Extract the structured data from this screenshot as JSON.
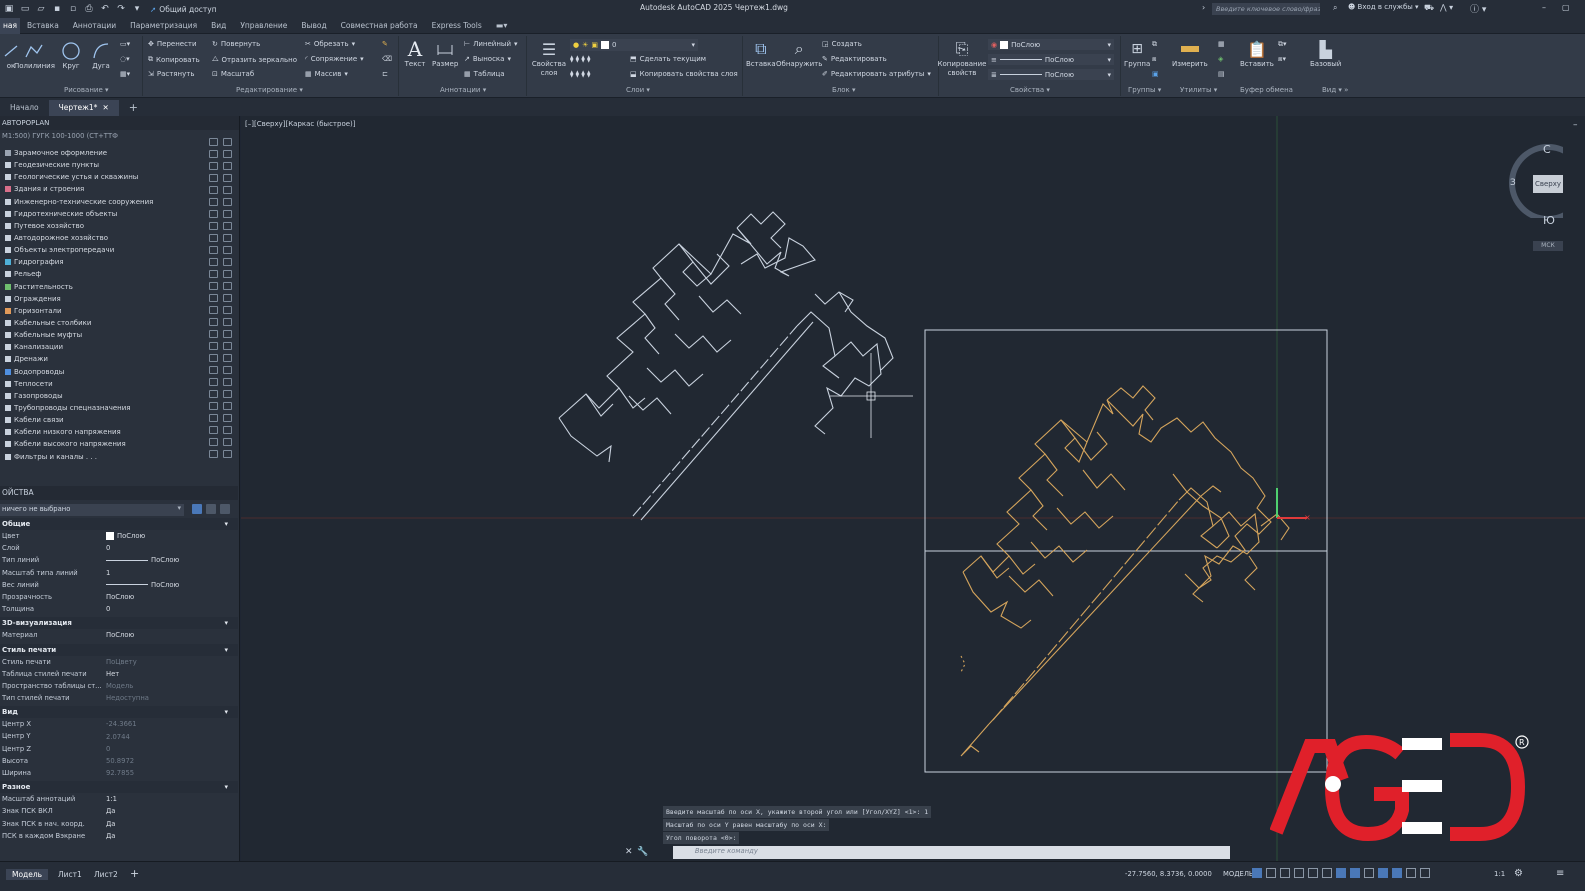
{
  "titlebar": {
    "share_label": "Общий доступ",
    "title": "Autodesk AutoCAD 2025    Чертеж1.dwg",
    "search_placeholder": "Введите ключевое слово/фразу",
    "login": "Вход в службы"
  },
  "menu": {
    "tabs": [
      "Главная",
      "Вставка",
      "Аннотации",
      "Параметризация",
      "Вид",
      "Управление",
      "Вывод",
      "Совместная работа",
      "Express Tools"
    ],
    "active_tab_visible": "ная"
  },
  "ribbon": {
    "draw": {
      "polyline": "Полилиния",
      "circle": "Круг",
      "arc": "Дуга",
      "line_partial": "ок",
      "panel": "Рисование"
    },
    "modify": {
      "move": "Перенести",
      "rotate": "Повернуть",
      "trim": "Обрезать",
      "copy": "Копировать",
      "mirror": "Отразить зеркально",
      "fillet": "Сопряжение",
      "stretch": "Растянуть",
      "scale": "Масштаб",
      "array": "Массив",
      "panel": "Редактирование"
    },
    "annotation": {
      "text": "Текст",
      "dimension": "Размер",
      "linear": "Линейный",
      "leader": "Выноска",
      "table": "Таблица",
      "panel": "Аннотации"
    },
    "layers": {
      "properties": "Свойства слоя",
      "current_layer": "0",
      "make_current": "Сделать текущим",
      "match_layer": "Копировать свойства слоя",
      "panel": "Слои"
    },
    "block": {
      "insert": "Вставка",
      "detect": "Обнаружить",
      "create": "Создать",
      "edit": "Редактировать",
      "edit_attr": "Редактировать атрибуты",
      "panel": "Блок"
    },
    "properties": {
      "match": "Копирование свойств",
      "color": "ПоСлою",
      "lineweight": "ПоСлою",
      "linetype": "ПоСлою",
      "panel": "Свойства"
    },
    "groups": {
      "group": "Группа",
      "panel": "Группы"
    },
    "utilities": {
      "measure": "Измерить",
      "panel": "Утилиты"
    },
    "clipboard": {
      "paste": "Вставить",
      "panel": "Буфер обмена"
    },
    "view": {
      "base": "Базовый",
      "panel": "Вид"
    }
  },
  "doctabs": {
    "start": "Начало",
    "drawing": "Чертеж1*",
    "new_tab": "+"
  },
  "layer_panel": {
    "title": "АВТОРОРLAN",
    "subtitle": "М1:500) ГУГК 100-1000 (СТ+ТТФ",
    "items": [
      "Зарамочное оформление",
      "Геодезические пункты",
      "Геологические устья и скважины",
      "Здания и строения",
      "Инженерно-технические сооружения",
      "Гидротехнические объекты",
      "Путевое хозяйство",
      "Автодорожное хозяйство",
      "Объекты электропередачи",
      "Гидрография",
      "Рельеф",
      "Растительность",
      "Ограждения",
      "Горизонтали",
      "Кабельные столбики",
      "Кабельные муфты",
      "Канализации",
      "Дренажи",
      "Водопроводы",
      "Теплосети",
      "Газопроводы",
      "Трубопроводы спецназначения",
      "Кабели связи",
      "Кабели низкого напряжения",
      "Кабели высокого напряжения",
      "Фильтры и каналы . . ."
    ],
    "item_colors": [
      "#9aa4b2",
      "#c9d2de",
      "#c9d2de",
      "#d86f8a",
      "#c9d2de",
      "#c9d2de",
      "#c9d2de",
      "#c9d2de",
      "#c9d2de",
      "#4fb0d8",
      "#c9d2de",
      "#6fbf6f",
      "#c9d2de",
      "#e09a5a",
      "#c9d2de",
      "#c9d2de",
      "#c9d2de",
      "#c9d2de",
      "#4f8fe0",
      "#c9d2de",
      "#c9d2de",
      "#c9d2de",
      "#c9d2de",
      "#c9d2de",
      "#c9d2de",
      "#c9d2de"
    ]
  },
  "properties": {
    "title": "ОЙСТВА",
    "selection": "ничего не выбрано",
    "sections": [
      {
        "name": "Общие",
        "rows": [
          {
            "k": "Цвет",
            "v": "ПоСлою",
            "type": "swatch"
          },
          {
            "k": "Слой",
            "v": "0"
          },
          {
            "k": "Тип линий",
            "v": "ПоСлою",
            "type": "line"
          },
          {
            "k": "Масштаб типа линий",
            "v": "1"
          },
          {
            "k": "Вес линий",
            "v": "ПоСлою",
            "type": "line"
          },
          {
            "k": "Прозрачность",
            "v": "ПоСлою"
          },
          {
            "k": "Толщина",
            "v": "0"
          }
        ]
      },
      {
        "name": "3D-визуализация",
        "rows": [
          {
            "k": "Материал",
            "v": "ПоСлою"
          }
        ]
      },
      {
        "name": "Стиль печати",
        "rows": [
          {
            "k": "Стиль печати",
            "v": "ПоЦвету",
            "dim": true
          },
          {
            "k": "Таблица стилей печати",
            "v": "Нет"
          },
          {
            "k": "Пространство таблицы ст...",
            "v": "Модель",
            "dim": true
          },
          {
            "k": "Тип стилей печати",
            "v": "Недоступна",
            "dim": true
          }
        ]
      },
      {
        "name": "Вид",
        "rows": [
          {
            "k": "Центр X",
            "v": "-24.3661",
            "dim": true
          },
          {
            "k": "Центр Y",
            "v": "2.0744",
            "dim": true
          },
          {
            "k": "Центр Z",
            "v": "0",
            "dim": true
          },
          {
            "k": "Высота",
            "v": "50.8972",
            "dim": true
          },
          {
            "k": "Ширина",
            "v": "92.7855",
            "dim": true
          }
        ]
      },
      {
        "name": "Разное",
        "rows": [
          {
            "k": "Масштаб аннотаций",
            "v": "1:1"
          },
          {
            "k": "Знак ПСК ВКЛ",
            "v": "Да"
          },
          {
            "k": "Знак ПСК в нач. коорд.",
            "v": "Да"
          },
          {
            "k": "ПСК в каждом Вэкране",
            "v": "Да"
          }
        ]
      }
    ]
  },
  "canvas": {
    "view_label": "[–][Сверху][Каркас (быстрое)]",
    "viewcube": {
      "north": "С",
      "south": "Ю",
      "west": "З",
      "top": "Сверху",
      "wcs": "МСК"
    },
    "colors": {
      "original": "#c9d2de",
      "transformed": "#d4a45c",
      "box": "#c9d2de"
    }
  },
  "command": {
    "history": [
      "Введите масштаб по оси X, укажите второй угол или [Угол/XYZ] <1>: 1",
      "Масштаб по оси Y равен масштабу по оси X:",
      "Угол поворота <0>:"
    ],
    "placeholder": "Введите  команду"
  },
  "statusbar": {
    "tabs": [
      "Модель",
      "Лист1",
      "Лист2"
    ],
    "add": "+",
    "coords": "-27.7560, 8.3736, 0.0000",
    "model": "МОДЕЛЬ",
    "scale": "1:1"
  },
  "brand": {
    "logo_text": "AGE",
    "color": "#e0202a"
  }
}
